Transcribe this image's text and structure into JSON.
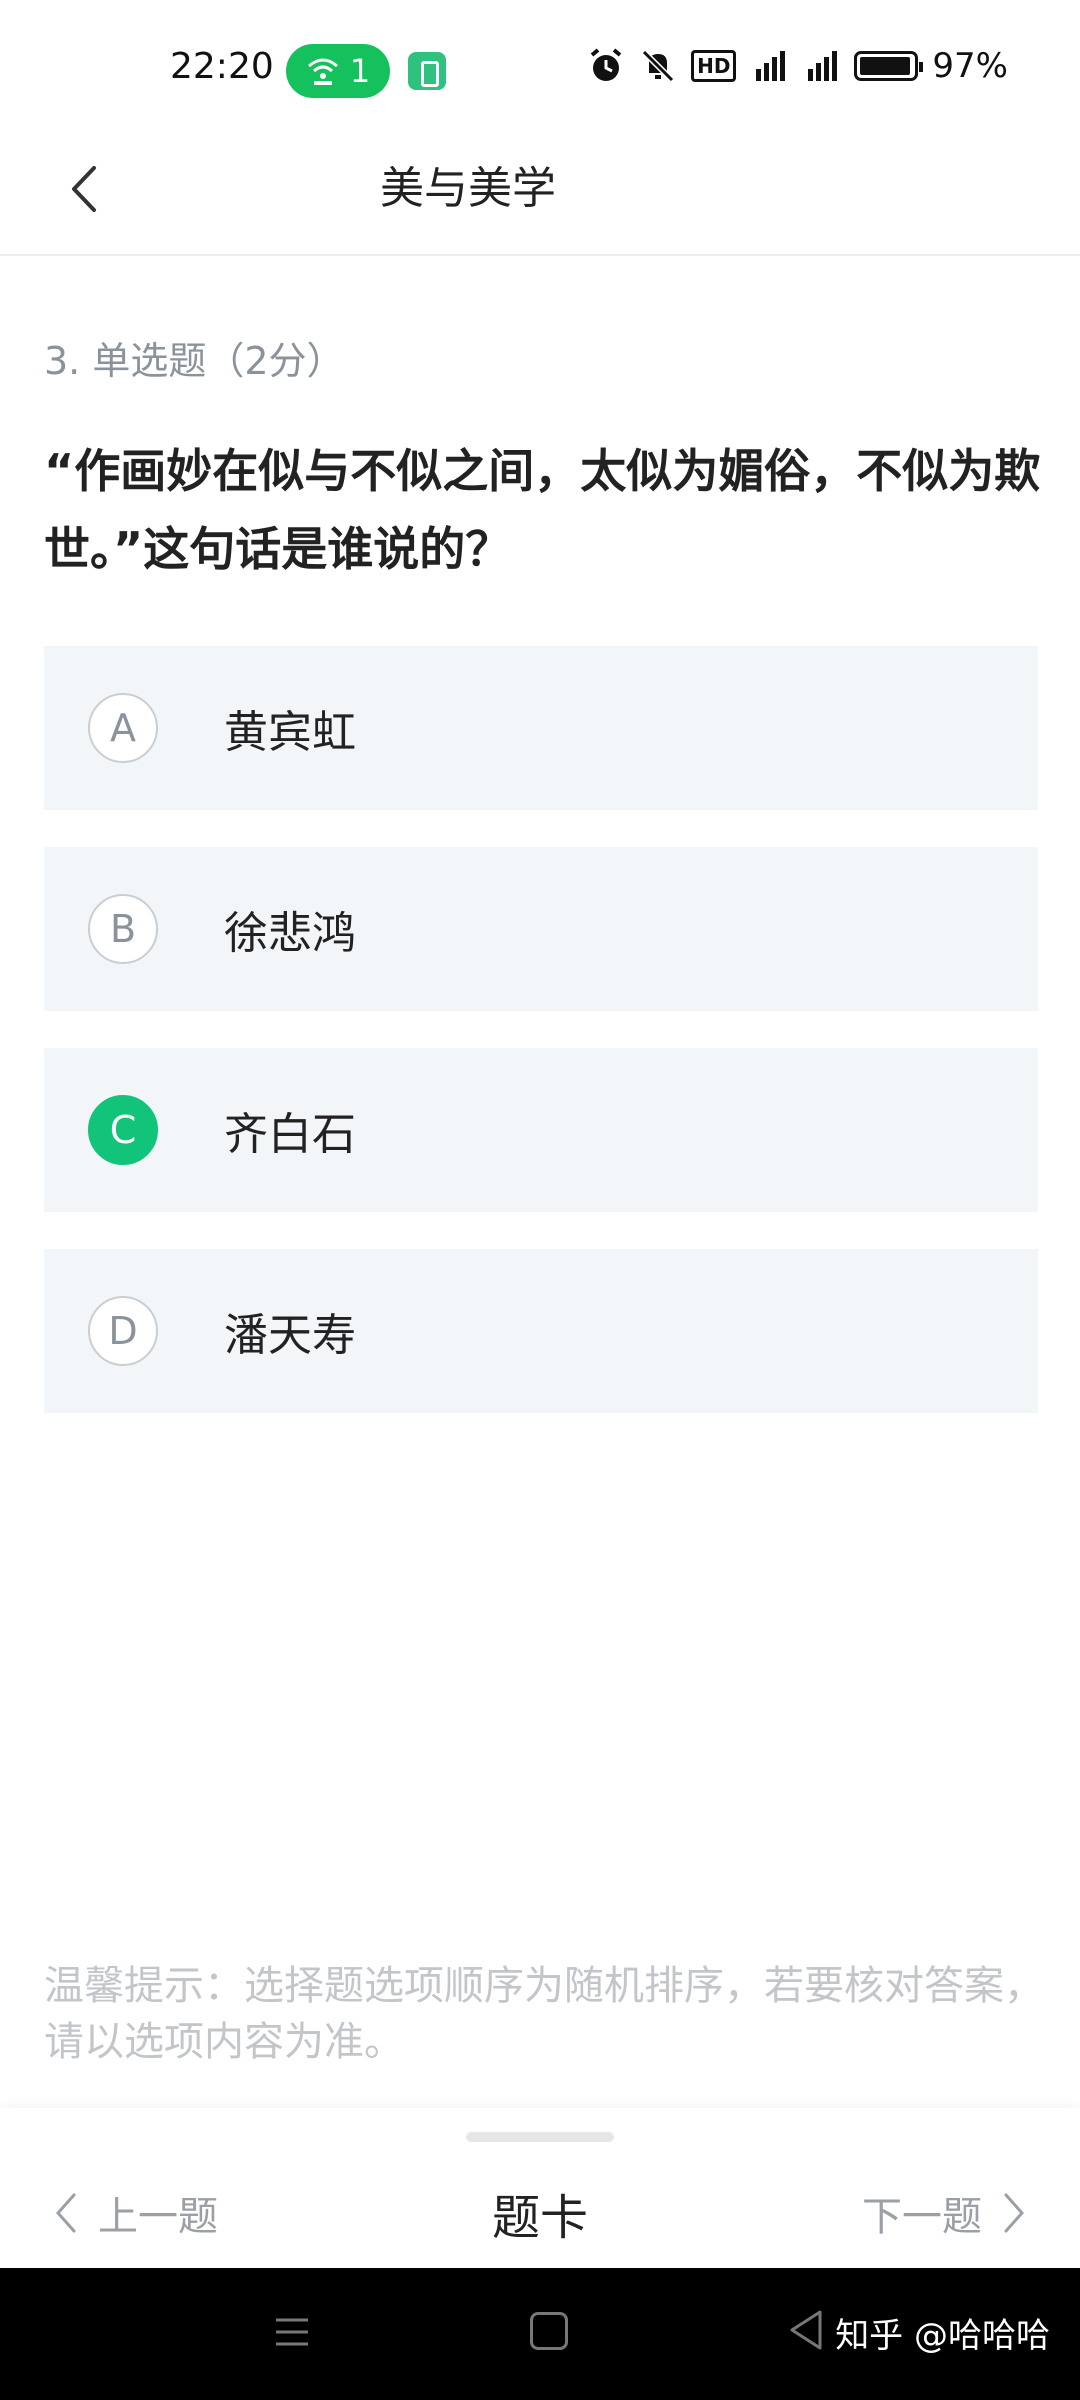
{
  "status_bar": {
    "time": "22:20",
    "hotspot_count": "1",
    "hd_label": "HD",
    "battery_percent": "97%"
  },
  "header": {
    "title": "美与美学",
    "back_icon": "chevron-left-icon"
  },
  "question": {
    "meta": "3. 单选题（2分）",
    "text": "“作画妙在似与不似之间，太似为媚俗，不似为欺世。”这句话是谁说的？"
  },
  "options": [
    {
      "letter": "A",
      "text": "黄宾虹",
      "selected": false
    },
    {
      "letter": "B",
      "text": "徐悲鸿",
      "selected": false
    },
    {
      "letter": "C",
      "text": "齐白石",
      "selected": true
    },
    {
      "letter": "D",
      "text": "潘天寿",
      "selected": false
    }
  ],
  "tip": "温馨提示：选择题选项顺序为随机排序，若要核对答案，请以选项内容为准。",
  "bottom_bar": {
    "prev_label": "上一题",
    "card_label": "题卡",
    "next_label": "下一题"
  },
  "watermark": "知乎 @哈哈哈",
  "colors": {
    "accent": "#12c47a",
    "option_bg": "#f2f6f9",
    "muted_text": "#8a939b"
  }
}
